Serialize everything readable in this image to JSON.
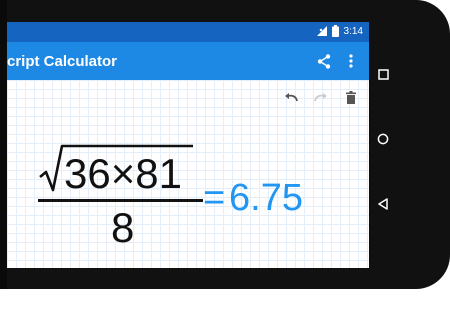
{
  "status_bar": {
    "time": "3:14",
    "signal_icon": "signal-icon",
    "battery_icon": "battery-icon"
  },
  "app_bar": {
    "title": "cript Calculator",
    "share_icon": "share-icon",
    "overflow_icon": "more-vert-icon"
  },
  "edit_tools": {
    "undo_icon": "undo-icon",
    "redo_icon": "redo-icon",
    "delete_icon": "trash-icon"
  },
  "expression": {
    "radicand": "36×81",
    "denominator": "8",
    "equals": "=",
    "result": "6.75"
  },
  "navigation": {
    "recents_icon": "square-icon",
    "home_icon": "circle-icon",
    "back_icon": "triangle-back-icon"
  },
  "colors": {
    "status_bar": "#1565c0",
    "app_bar": "#1e88e5",
    "result_blue": "#2196f3",
    "phone_body": "#111111",
    "grid_line": "#e3eef8"
  }
}
